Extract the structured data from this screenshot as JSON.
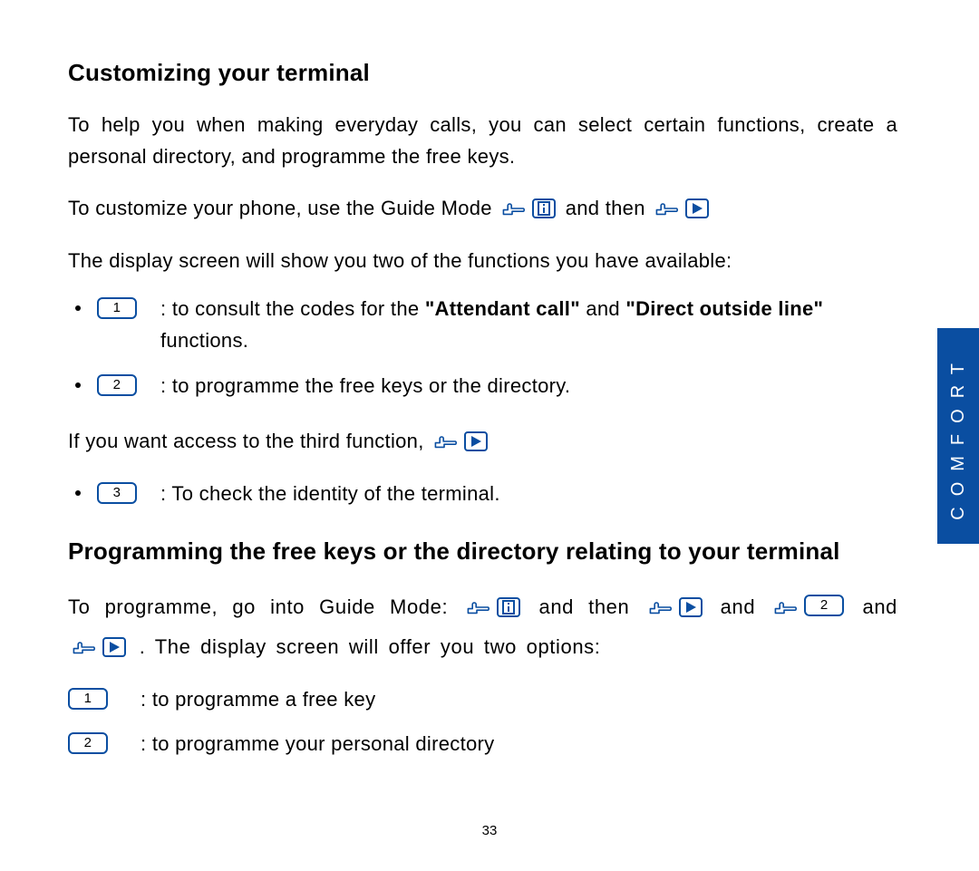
{
  "page_number": "33",
  "sidebar_label": "COMFORT",
  "heading1": "Customizing your terminal",
  "intro_paragraph": "To help you when making everyday calls, you can select certain functions, create a personal directory, and programme the free keys.",
  "customize_line_prefix": "To customize your phone, use the Guide Mode",
  "and_then": "and then",
  "display_line": "The display screen will show you two of the functions you have available:",
  "bullet1_key": "1",
  "bullet1_prefix": ": to consult the codes for the ",
  "bullet1_bold1": "\"Attendant call\"",
  "bullet1_mid": " and ",
  "bullet1_bold2": "\"Direct outside line\"",
  "bullet1_suffix": " functions.",
  "bullet2_key": "2",
  "bullet2_text": ": to programme the free keys or the directory.",
  "third_function_prefix": "If you want access to the third function,",
  "bullet3_key": "3",
  "bullet3_text": ": To check the identity of the terminal.",
  "heading2": "Programming the free keys or the directory relating to your terminal",
  "prog_prefix": "To programme, go into Guide Mode:",
  "and_word": "and",
  "prog_key2": "2",
  "prog_suffix": ". The display screen will offer you two options:",
  "opt1_key": "1",
  "opt1_text": ": to programme a free key",
  "opt2_key": "2",
  "opt2_text": ": to programme your personal directory"
}
